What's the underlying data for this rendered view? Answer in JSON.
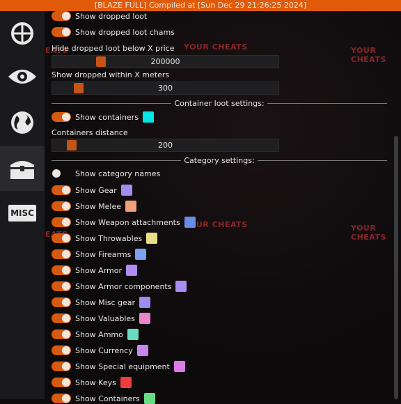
{
  "title": "[BLAZE FULL] Compiled at [Sun Dec 29 21:26:25 2024]",
  "sidebar": {
    "misc_label": "MISC"
  },
  "watermark": "YOUR CHEATS",
  "loot": {
    "show_dropped_loot": "Show dropped loot",
    "show_dropped_loot_chams": "Show dropped loot chams",
    "hide_below_label": "Hide dropped loot below X price",
    "hide_below_value": "200000",
    "within_label": "Show dropped within X meters",
    "within_value": "300"
  },
  "container": {
    "header": "Container loot settings:",
    "show_containers": "Show containers",
    "show_containers_color": "#00e5e5",
    "distance_label": "Containers distance",
    "distance_value": "200"
  },
  "category": {
    "header": "Category settings:",
    "items": [
      {
        "label": "Show category names",
        "on": false,
        "color": ""
      },
      {
        "label": "Show Gear",
        "on": true,
        "color": "#a58cf0"
      },
      {
        "label": "Show Melee",
        "on": true,
        "color": "#f0a07a"
      },
      {
        "label": "Show Weapon attachments",
        "on": true,
        "color": "#6a8ce6"
      },
      {
        "label": "Show Throwables",
        "on": true,
        "color": "#e9dd87"
      },
      {
        "label": "Show Firearms",
        "on": true,
        "color": "#7aa2f0"
      },
      {
        "label": "Show Armor",
        "on": true,
        "color": "#b08cf0"
      },
      {
        "label": "Show Armor components",
        "on": true,
        "color": "#a98cf0"
      },
      {
        "label": "Show Misc gear",
        "on": true,
        "color": "#9a8cf0"
      },
      {
        "label": "Show Valuables",
        "on": true,
        "color": "#e687c9"
      },
      {
        "label": "Show Ammo",
        "on": true,
        "color": "#67dcc0"
      },
      {
        "label": "Show Currency",
        "on": true,
        "color": "#c687f0"
      },
      {
        "label": "Show Special equipment",
        "on": true,
        "color": "#dc7ae6"
      },
      {
        "label": "Show Keys",
        "on": true,
        "color": "#f03c3c"
      },
      {
        "label": "Show Containers",
        "on": true,
        "color": "#67dc87"
      }
    ]
  }
}
